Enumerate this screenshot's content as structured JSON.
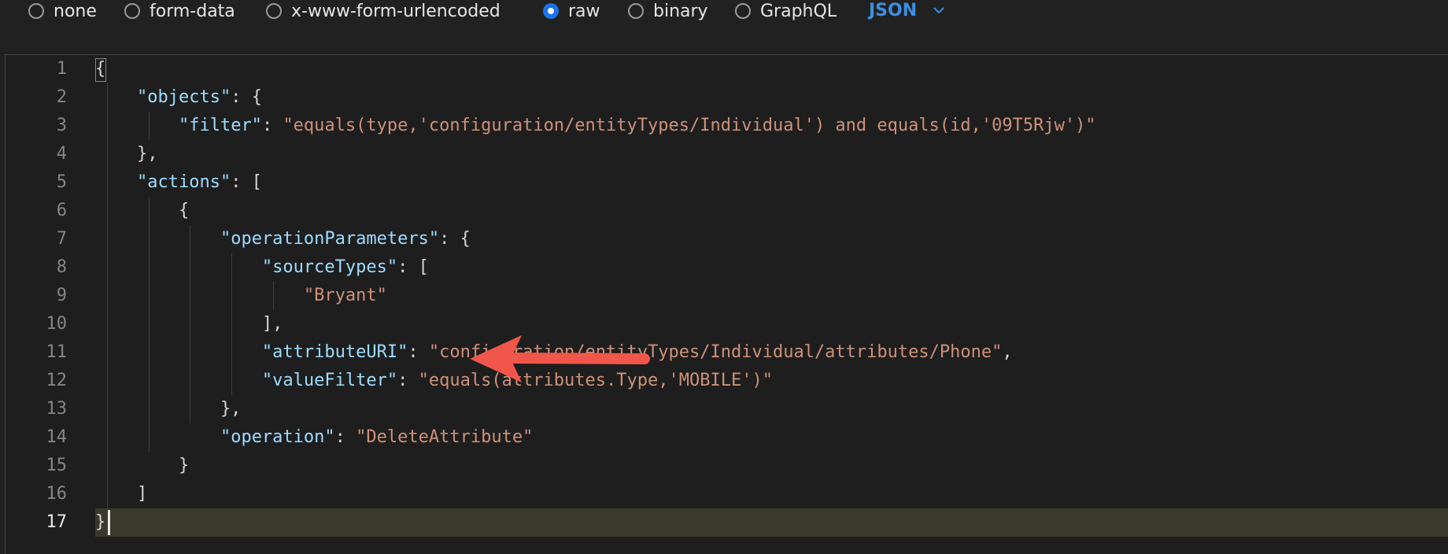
{
  "body_types": [
    {
      "label": "none",
      "selected": false
    },
    {
      "label": "form-data",
      "selected": false
    },
    {
      "label": "x-www-form-urlencoded",
      "selected": false
    },
    {
      "label": "raw",
      "selected": true
    },
    {
      "label": "binary",
      "selected": false
    },
    {
      "label": "GraphQL",
      "selected": false
    }
  ],
  "format_dropdown": {
    "label": "JSON",
    "icon": "chevron-down-icon"
  },
  "editor": {
    "line_numbers": [
      "1",
      "2",
      "3",
      "4",
      "5",
      "6",
      "7",
      "8",
      "9",
      "10",
      "11",
      "12",
      "13",
      "14",
      "15",
      "16",
      "17"
    ],
    "lines": [
      [
        {
          "t": "{",
          "c": "p"
        }
      ],
      [
        {
          "t": "    ",
          "c": "p"
        },
        {
          "t": "\"objects\"",
          "c": "k"
        },
        {
          "t": ": {",
          "c": "p"
        }
      ],
      [
        {
          "t": "        ",
          "c": "p"
        },
        {
          "t": "\"filter\"",
          "c": "k"
        },
        {
          "t": ": ",
          "c": "p"
        },
        {
          "t": "\"equals(type,'configuration/entityTypes/Individual') and equals(id,'09T5Rjw')\"",
          "c": "s"
        }
      ],
      [
        {
          "t": "    },",
          "c": "p"
        }
      ],
      [
        {
          "t": "    ",
          "c": "p"
        },
        {
          "t": "\"actions\"",
          "c": "k"
        },
        {
          "t": ": [",
          "c": "p"
        }
      ],
      [
        {
          "t": "        {",
          "c": "p"
        }
      ],
      [
        {
          "t": "            ",
          "c": "p"
        },
        {
          "t": "\"operationParameters\"",
          "c": "k"
        },
        {
          "t": ": {",
          "c": "p"
        }
      ],
      [
        {
          "t": "                ",
          "c": "p"
        },
        {
          "t": "\"sourceTypes\"",
          "c": "k"
        },
        {
          "t": ": [",
          "c": "p"
        }
      ],
      [
        {
          "t": "                    ",
          "c": "p"
        },
        {
          "t": "\"Bryant\"",
          "c": "s"
        }
      ],
      [
        {
          "t": "                ],",
          "c": "p"
        }
      ],
      [
        {
          "t": "                ",
          "c": "p"
        },
        {
          "t": "\"attributeURI\"",
          "c": "k"
        },
        {
          "t": ": ",
          "c": "p"
        },
        {
          "t": "\"configuration/entityTypes/Individual/attributes/Phone\"",
          "c": "s"
        },
        {
          "t": ",",
          "c": "p"
        }
      ],
      [
        {
          "t": "                ",
          "c": "p"
        },
        {
          "t": "\"valueFilter\"",
          "c": "k"
        },
        {
          "t": ": ",
          "c": "p"
        },
        {
          "t": "\"equals(attributes.Type,'MOBILE')\"",
          "c": "s"
        }
      ],
      [
        {
          "t": "            },",
          "c": "p"
        }
      ],
      [
        {
          "t": "            ",
          "c": "p"
        },
        {
          "t": "\"operation\"",
          "c": "k"
        },
        {
          "t": ": ",
          "c": "p"
        },
        {
          "t": "\"DeleteAttribute\"",
          "c": "s"
        }
      ],
      [
        {
          "t": "        }",
          "c": "p"
        }
      ],
      [
        {
          "t": "    ]",
          "c": "p"
        }
      ],
      [
        {
          "t": "}",
          "c": "p"
        }
      ]
    ],
    "current_line": 17
  },
  "colors": {
    "accent": "#1a73e8",
    "json_label": "#3d8fe0",
    "key": "#9cdcfe",
    "string": "#ce9178",
    "arrow": "#f0574a"
  }
}
